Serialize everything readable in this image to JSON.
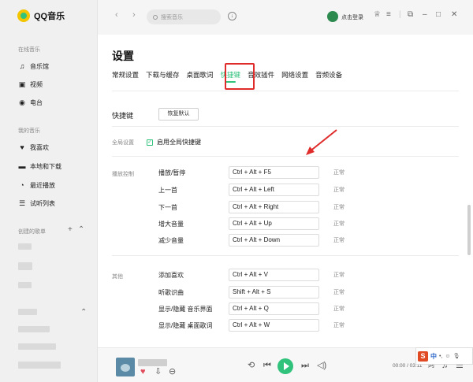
{
  "app": {
    "name": "QQ音乐"
  },
  "sidebar": {
    "sections": [
      {
        "label": "在线音乐",
        "items": [
          {
            "label": "音乐馆",
            "icon": "music-note-icon"
          },
          {
            "label": "视频",
            "icon": "video-icon"
          },
          {
            "label": "电台",
            "icon": "radio-icon"
          }
        ]
      },
      {
        "label": "我的音乐",
        "items": [
          {
            "label": "我喜欢",
            "icon": "heart-icon"
          },
          {
            "label": "本地和下载",
            "icon": "monitor-icon"
          },
          {
            "label": "最近播放",
            "icon": "clock-icon"
          },
          {
            "label": "试听列表",
            "icon": "playlist-icon"
          }
        ]
      },
      {
        "label": "创建的歌单",
        "items": []
      }
    ]
  },
  "topbar": {
    "search_placeholder": "搜索音乐",
    "login_text": "点击登录"
  },
  "settings": {
    "title": "设置",
    "tabs": [
      "常规设置",
      "下载与缓存",
      "桌面歌词",
      "快捷键",
      "音效插件",
      "网络设置",
      "音频设备"
    ],
    "active_tab": "快捷键",
    "section_title": "快捷键",
    "restore_label": "恢复默认",
    "global_label": "全局设置",
    "global_checkbox_label": "启用全局快捷键",
    "global_checked": true,
    "groups": [
      {
        "label": "播放控制",
        "rows": [
          {
            "name": "播放/暂停",
            "keys": "Ctrl + Alt + F5",
            "status": "正常"
          },
          {
            "name": "上一首",
            "keys": "Ctrl + Alt + Left",
            "status": "正常"
          },
          {
            "name": "下一首",
            "keys": "Ctrl + Alt + Right",
            "status": "正常"
          },
          {
            "name": "增大音量",
            "keys": "Ctrl + Alt + Up",
            "status": "正常"
          },
          {
            "name": "减少音量",
            "keys": "Ctrl + Alt + Down",
            "status": "正常"
          }
        ]
      },
      {
        "label": "其他",
        "rows": [
          {
            "name": "添加喜欢",
            "keys": "Ctrl + Alt + V",
            "status": "正常"
          },
          {
            "name": "听歌识曲",
            "keys": "Shift + Alt + S",
            "status": "正常"
          },
          {
            "name": "显示/隐藏 音乐界面",
            "keys": "Ctrl + Alt + Q",
            "status": "正常"
          },
          {
            "name": "显示/隐藏 桌面歌词",
            "keys": "Ctrl + Alt + W",
            "status": "正常"
          }
        ]
      }
    ]
  },
  "player": {
    "time": "00:00 / 03:11"
  },
  "ime": {
    "mode": "中"
  },
  "colors": {
    "accent": "#31c27c",
    "highlight": "#e02b2b"
  }
}
